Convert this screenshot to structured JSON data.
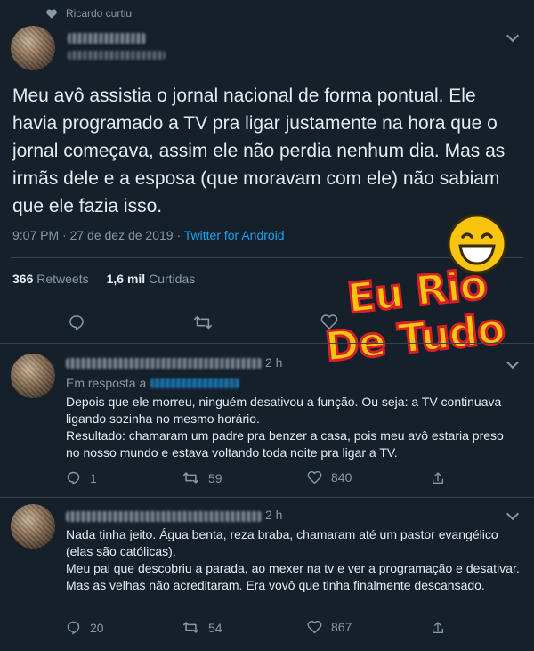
{
  "context": {
    "liked_by": "Ricardo curtiu"
  },
  "tweet": {
    "text": "Meu avô assistia o jornal nacional de forma pontual. Ele havia programado a TV pra ligar justamente na hora que o jornal começava, assim ele não perdia nenhum dia. Mas as irmãs dele e a esposa (que moravam com ele) não sabiam que ele fazia isso.",
    "time": "9:07 PM · 27 de dez de 2019 · ",
    "source": "Twitter for Android",
    "retweets_count": "366",
    "retweets_label": "Retweets",
    "likes_count": "1,6 mil",
    "likes_label": "Curtidas"
  },
  "watermark": {
    "line1": "Eu Rio",
    "line2": "De Tudo"
  },
  "replies": [
    {
      "time": "2 h",
      "in_reply_to": "Em resposta a",
      "paragraphs": [
        "Depois que ele morreu, ninguém desativou a função. Ou seja: a TV continuava ligando sozinha no mesmo horário.",
        "Resultado: chamaram um padre pra benzer a casa, pois meu avô estaria preso no nosso mundo e estava voltando toda noite pra ligar a TV."
      ],
      "replies": "1",
      "retweets": "59",
      "likes": "840"
    },
    {
      "time": "2 h",
      "paragraphs": [
        "Nada tinha jeito. Água benta, reza braba, chamaram até um pastor evangélico (elas são católicas).",
        "Meu pai que descobriu a parada, ao mexer na tv e ver a programação e desativar.",
        "Mas as velhas não acreditaram. Era vovô que tinha finalmente descansado."
      ],
      "replies": "20",
      "retweets": "54",
      "likes": "867"
    }
  ],
  "colors": {
    "background": "#15202b",
    "text": "#e6ecf0",
    "muted": "#8899a6",
    "link": "#1da1f2",
    "divider": "#38444d",
    "watermark_red": "#d81e27",
    "watermark_yellow": "#f7c510"
  },
  "icons": [
    "heart-icon",
    "chevron-down-icon",
    "reply-icon",
    "retweet-icon",
    "share-icon",
    "laughing-emoji-icon"
  ]
}
